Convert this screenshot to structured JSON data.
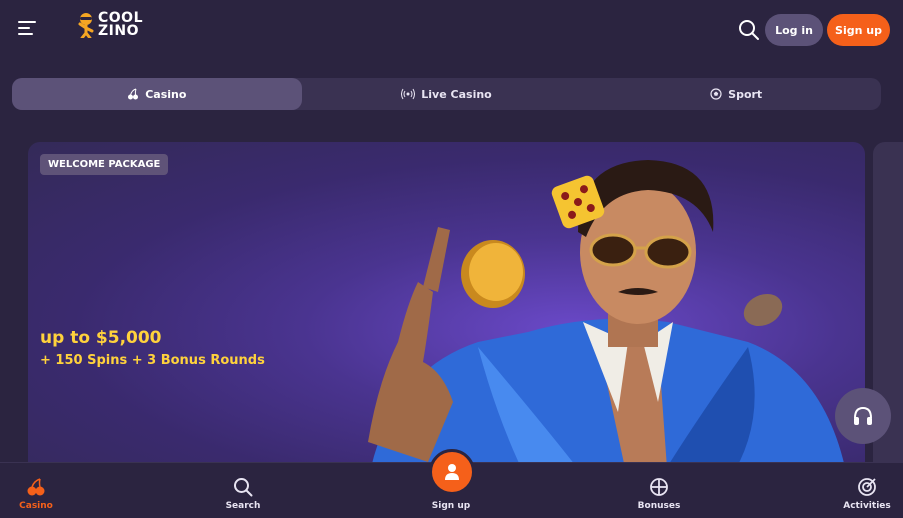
{
  "header": {
    "logo_line1": "COOL",
    "logo_line2": "ZINO",
    "login_label": "Log in",
    "signup_label": "Sign up"
  },
  "tabs": [
    {
      "label": "Casino",
      "icon": "cherry-icon",
      "active": true
    },
    {
      "label": "Live Casino",
      "icon": "broadcast-icon",
      "active": false
    },
    {
      "label": "Sport",
      "icon": "soccer-ball-icon",
      "active": false
    }
  ],
  "banner": {
    "badge": "WELCOME PACKAGE",
    "amount": "up to $5,000",
    "subtitle": "+ 150 Spins + 3 Bonus Rounds"
  },
  "bottom_nav": [
    {
      "label": "Casino",
      "icon": "cherry-icon",
      "active": true
    },
    {
      "label": "Search",
      "icon": "search-icon",
      "active": false
    },
    {
      "label": "Sign up",
      "icon": "user-icon",
      "active": false
    },
    {
      "label": "Bonuses",
      "icon": "gift-icon",
      "active": false
    },
    {
      "label": "Activities",
      "icon": "target-icon",
      "active": false
    }
  ],
  "colors": {
    "background": "#2b2440",
    "accent": "#f5601a",
    "tab_active": "#5c5278",
    "promo_text": "#ffd23c"
  }
}
